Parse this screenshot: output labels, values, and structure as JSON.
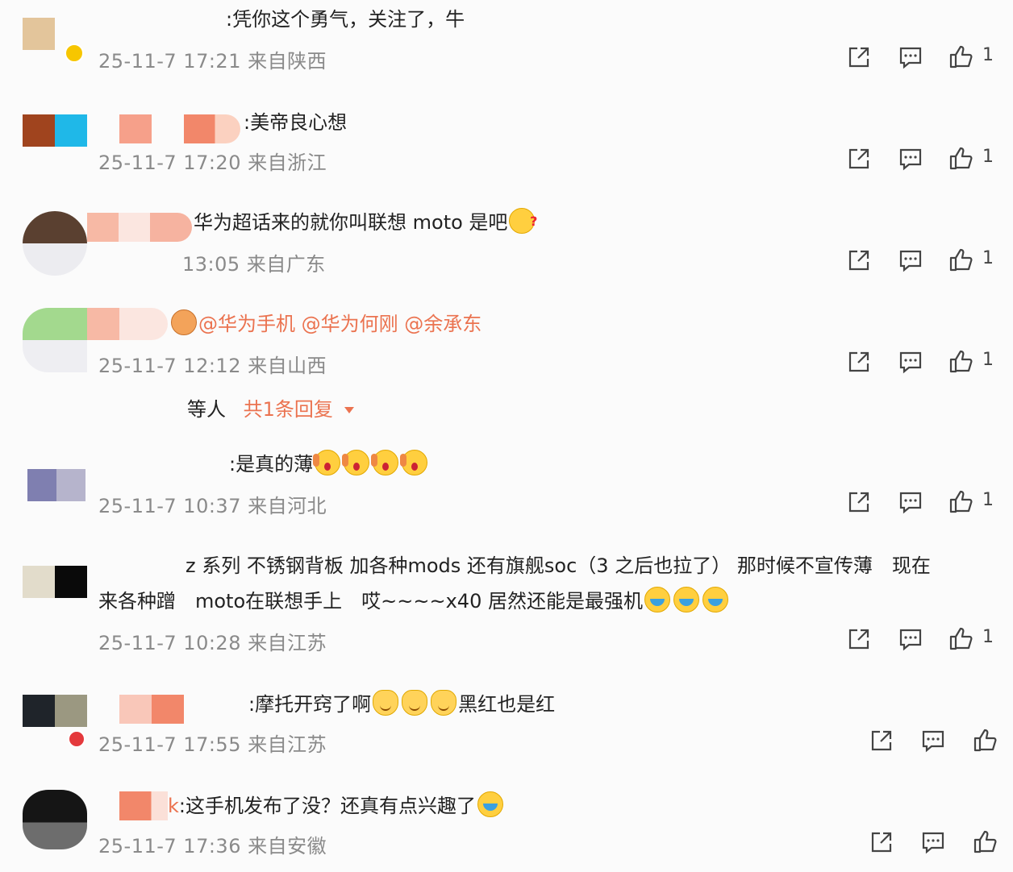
{
  "comments": [
    {
      "text": ":凭你这个勇气，关注了，牛",
      "meta": "25-11-7 17:21 来自陕西",
      "likes": "1"
    },
    {
      "text": ":美帝良心想",
      "meta": "25-11-7 17:20 来自浙江",
      "likes": "1"
    },
    {
      "text": "华为超话来的就你叫联想 moto 是吧",
      "meta": "13:05 来自广东",
      "likes": "1"
    },
    {
      "text_mentions": "@华为手机 @华为何刚 @余承东",
      "meta": "25-11-7 12:12 来自山西",
      "likes": "1",
      "reply_author": "等人",
      "reply_link": "共1条回复"
    },
    {
      "text": ":是真的薄",
      "meta": "25-11-7 10:37 来自河北",
      "likes": "1"
    },
    {
      "text_line1": "z 系列 不锈钢背板 加各种mods 还有旗舰soc（3 之后也拉了） 那时候不宣传薄　现在",
      "text_line2": "来各种蹭　moto在联想手上　哎~~~~x40 居然还能是最强机",
      "meta": "25-11-7 10:28 来自江苏",
      "likes": "1"
    },
    {
      "text_a": ":摩托开窍了啊",
      "text_b": "黑红也是红",
      "meta": "25-11-7 17:55 来自江苏"
    },
    {
      "text_prefix": "k",
      "text": ":这手机发布了没？还真有点兴趣了",
      "meta": "25-11-7 17:36 来自安徽"
    }
  ],
  "icons": {
    "share": "share-icon",
    "comment": "comment-icon",
    "like": "like-icon"
  },
  "colors": {
    "mention": "#eb7350",
    "meta": "#8a8a8a",
    "icon": "#444444"
  }
}
